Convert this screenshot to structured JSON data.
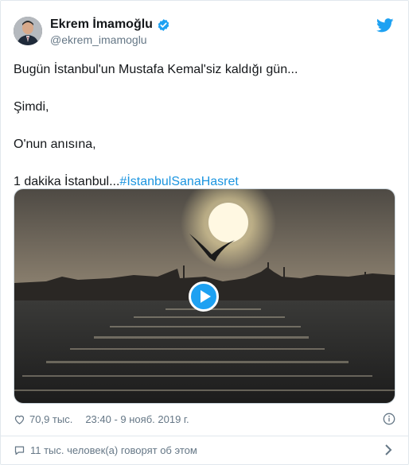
{
  "author": {
    "name": "Ekrem İmamoğlu",
    "handle": "@ekrem_imamoglu"
  },
  "tweet": {
    "line1": "Bugün İstanbul'un Mustafa Kemal'siz kaldığı gün...",
    "line2": "Şimdi,",
    "line3": "O'nun anısına,",
    "line4_prefix": "1 dakika İstanbul...",
    "hashtag": "#İstanbulSanaHasret"
  },
  "meta": {
    "likes": "70,9 тыс.",
    "timestamp": "23:40 - 9 нояб. 2019 г."
  },
  "conversation": {
    "label": "11 тыс. человек(а) говорят об этом"
  },
  "icons": {
    "verified": "verified-badge-icon",
    "brand": "twitter-bird-icon",
    "like": "heart-icon",
    "info": "info-icon",
    "reply": "speech-bubble-icon",
    "chevron": "chevron-right-icon",
    "play": "play-icon"
  },
  "colors": {
    "accent": "#1da1f2",
    "link": "#1b95e0",
    "secondary_text": "#657786"
  }
}
